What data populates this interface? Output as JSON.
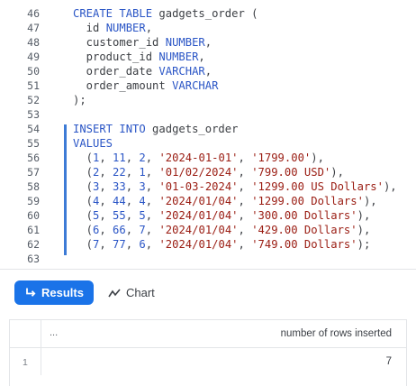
{
  "editor": {
    "lines": [
      {
        "n": "46",
        "segs": [
          {
            "t": "CREATE TABLE",
            "c": "kw"
          },
          {
            "t": " gadgets_order (",
            "c": ""
          }
        ]
      },
      {
        "n": "47",
        "segs": [
          {
            "t": "  id ",
            "c": ""
          },
          {
            "t": "NUMBER",
            "c": "kw"
          },
          {
            "t": ",",
            "c": ""
          }
        ]
      },
      {
        "n": "48",
        "segs": [
          {
            "t": "  customer_id ",
            "c": ""
          },
          {
            "t": "NUMBER",
            "c": "kw"
          },
          {
            "t": ",",
            "c": ""
          }
        ]
      },
      {
        "n": "49",
        "segs": [
          {
            "t": "  product_id ",
            "c": ""
          },
          {
            "t": "NUMBER",
            "c": "kw"
          },
          {
            "t": ",",
            "c": ""
          }
        ]
      },
      {
        "n": "50",
        "segs": [
          {
            "t": "  order_date ",
            "c": ""
          },
          {
            "t": "VARCHAR",
            "c": "kw"
          },
          {
            "t": ",",
            "c": ""
          }
        ]
      },
      {
        "n": "51",
        "segs": [
          {
            "t": "  order_amount ",
            "c": ""
          },
          {
            "t": "VARCHAR",
            "c": "kw"
          }
        ]
      },
      {
        "n": "52",
        "segs": [
          {
            "t": ");",
            "c": ""
          }
        ]
      },
      {
        "n": "53",
        "segs": []
      },
      {
        "n": "54",
        "segs": [
          {
            "t": "INSERT INTO",
            "c": "kw"
          },
          {
            "t": " gadgets_order",
            "c": ""
          }
        ]
      },
      {
        "n": "55",
        "segs": [
          {
            "t": "VALUES",
            "c": "kw"
          }
        ]
      },
      {
        "n": "56",
        "segs": [
          {
            "t": "  (",
            "c": ""
          },
          {
            "t": "1",
            "c": "num"
          },
          {
            "t": ", ",
            "c": ""
          },
          {
            "t": "11",
            "c": "num"
          },
          {
            "t": ", ",
            "c": ""
          },
          {
            "t": "2",
            "c": "num"
          },
          {
            "t": ", ",
            "c": ""
          },
          {
            "t": "'2024-01-01'",
            "c": "str"
          },
          {
            "t": ", ",
            "c": ""
          },
          {
            "t": "'1799.00'",
            "c": "str"
          },
          {
            "t": "),",
            "c": ""
          }
        ]
      },
      {
        "n": "57",
        "segs": [
          {
            "t": "  (",
            "c": ""
          },
          {
            "t": "2",
            "c": "num"
          },
          {
            "t": ", ",
            "c": ""
          },
          {
            "t": "22",
            "c": "num"
          },
          {
            "t": ", ",
            "c": ""
          },
          {
            "t": "1",
            "c": "num"
          },
          {
            "t": ", ",
            "c": ""
          },
          {
            "t": "'01/02/2024'",
            "c": "str"
          },
          {
            "t": ", ",
            "c": ""
          },
          {
            "t": "'799.00 USD'",
            "c": "str"
          },
          {
            "t": "),",
            "c": ""
          }
        ]
      },
      {
        "n": "58",
        "segs": [
          {
            "t": "  (",
            "c": ""
          },
          {
            "t": "3",
            "c": "num"
          },
          {
            "t": ", ",
            "c": ""
          },
          {
            "t": "33",
            "c": "num"
          },
          {
            "t": ", ",
            "c": ""
          },
          {
            "t": "3",
            "c": "num"
          },
          {
            "t": ", ",
            "c": ""
          },
          {
            "t": "'01-03-2024'",
            "c": "str"
          },
          {
            "t": ", ",
            "c": ""
          },
          {
            "t": "'1299.00 US Dollars'",
            "c": "str"
          },
          {
            "t": "),",
            "c": ""
          }
        ]
      },
      {
        "n": "59",
        "segs": [
          {
            "t": "  (",
            "c": ""
          },
          {
            "t": "4",
            "c": "num"
          },
          {
            "t": ", ",
            "c": ""
          },
          {
            "t": "44",
            "c": "num"
          },
          {
            "t": ", ",
            "c": ""
          },
          {
            "t": "4",
            "c": "num"
          },
          {
            "t": ", ",
            "c": ""
          },
          {
            "t": "'2024/01/04'",
            "c": "str"
          },
          {
            "t": ", ",
            "c": ""
          },
          {
            "t": "'1299.00 Dollars'",
            "c": "str"
          },
          {
            "t": "),",
            "c": ""
          }
        ]
      },
      {
        "n": "60",
        "segs": [
          {
            "t": "  (",
            "c": ""
          },
          {
            "t": "5",
            "c": "num"
          },
          {
            "t": ", ",
            "c": ""
          },
          {
            "t": "55",
            "c": "num"
          },
          {
            "t": ", ",
            "c": ""
          },
          {
            "t": "5",
            "c": "num"
          },
          {
            "t": ", ",
            "c": ""
          },
          {
            "t": "'2024/01/04'",
            "c": "str"
          },
          {
            "t": ", ",
            "c": ""
          },
          {
            "t": "'300.00 Dollars'",
            "c": "str"
          },
          {
            "t": "),",
            "c": ""
          }
        ]
      },
      {
        "n": "61",
        "segs": [
          {
            "t": "  (",
            "c": ""
          },
          {
            "t": "6",
            "c": "num"
          },
          {
            "t": ", ",
            "c": ""
          },
          {
            "t": "66",
            "c": "num"
          },
          {
            "t": ", ",
            "c": ""
          },
          {
            "t": "7",
            "c": "num"
          },
          {
            "t": ", ",
            "c": ""
          },
          {
            "t": "'2024/01/04'",
            "c": "str"
          },
          {
            "t": ", ",
            "c": ""
          },
          {
            "t": "'429.00 Dollars'",
            "c": "str"
          },
          {
            "t": "),",
            "c": ""
          }
        ]
      },
      {
        "n": "62",
        "segs": [
          {
            "t": "  (",
            "c": ""
          },
          {
            "t": "7",
            "c": "num"
          },
          {
            "t": ", ",
            "c": ""
          },
          {
            "t": "77",
            "c": "num"
          },
          {
            "t": ", ",
            "c": ""
          },
          {
            "t": "6",
            "c": "num"
          },
          {
            "t": ", ",
            "c": ""
          },
          {
            "t": "'2024/01/04'",
            "c": "str"
          },
          {
            "t": ", ",
            "c": ""
          },
          {
            "t": "'749.00 Dollars'",
            "c": "str"
          },
          {
            "t": ");",
            "c": ""
          }
        ]
      },
      {
        "n": "63",
        "segs": []
      }
    ]
  },
  "tabs": {
    "results_label": "Results",
    "results_icon": "return-arrow-icon",
    "chart_label": "Chart",
    "chart_icon": "line-chart-icon"
  },
  "results": {
    "index_header": "...",
    "column_header": "number of rows inserted",
    "rows": [
      {
        "index": "1",
        "value": "7"
      }
    ]
  },
  "colors": {
    "accent": "#1a73e8",
    "keyword": "#2b56c6",
    "string": "#9a1c12",
    "selection_bar": "#3d7bd6"
  }
}
